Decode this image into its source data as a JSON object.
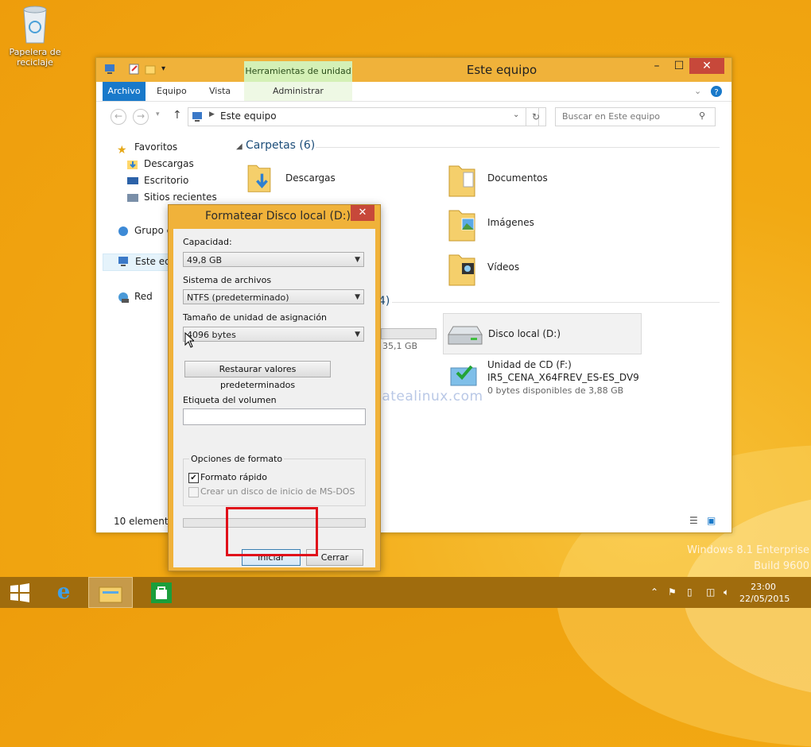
{
  "desktop": {
    "recycle_bin_label_line1": "Papelera de",
    "recycle_bin_label_line2": "reciclaje"
  },
  "explorer": {
    "title": "Este equipo",
    "tools_tab": "Herramientas de unidad",
    "ribbon_tabs": [
      "Archivo",
      "Equipo",
      "Vista",
      "Administrar"
    ],
    "address_path": "Este equipo",
    "search_placeholder": "Buscar en Este equipo",
    "nav": {
      "favorites": "Favoritos",
      "descargas": "Descargas",
      "escritorio": "Escritorio",
      "sitios": "Sitios recientes",
      "grupo": "Grupo e",
      "este": "Este equ",
      "red": "Red"
    },
    "folders_section": "Carpetas (6)",
    "folders": [
      "Descargas",
      "Documentos",
      "Imágenes",
      "Vídeos"
    ],
    "devices_section_fragment": "4)",
    "device_c_size_fragment": "35,1 GB",
    "drive_d": "Disco local (D:)",
    "cd_name": "Unidad de CD (F:)",
    "cd_label": "IR5_CENA_X64FREV_ES-ES_DV9",
    "cd_space": "0 bytes disponibles de 3,88 GB",
    "status": "10 elementos"
  },
  "dialog": {
    "title": "Formatear Disco local (D:)",
    "capacity_label": "Capacidad:",
    "capacity_value": "49,8 GB",
    "fs_label": "Sistema de archivos",
    "fs_value": "NTFS (predeterminado)",
    "alloc_label": "Tamaño de unidad de asignación",
    "alloc_value": "4096 bytes",
    "restore_button": "Restaurar valores predeterminados",
    "volume_label": "Etiqueta del volumen",
    "volume_value": "",
    "options_label": "Opciones de formato",
    "quick_format": "Formato rápido",
    "quick_format_checked": true,
    "msdos": "Crear un disco de inicio de MS-DOS",
    "start_button": "Iniciar",
    "close_button": "Cerrar"
  },
  "watermark": "cambiatealinux.com",
  "branding": {
    "line1": "Windows 8.1 Enterprise",
    "line2": "Build 9600"
  },
  "taskbar": {
    "time": "23:00",
    "date": "22/05/2015"
  },
  "colors": {
    "accent": "#1979ca",
    "window_frame": "#f0b23a",
    "close_red": "#c7483a",
    "highlight": "#e0101a"
  }
}
